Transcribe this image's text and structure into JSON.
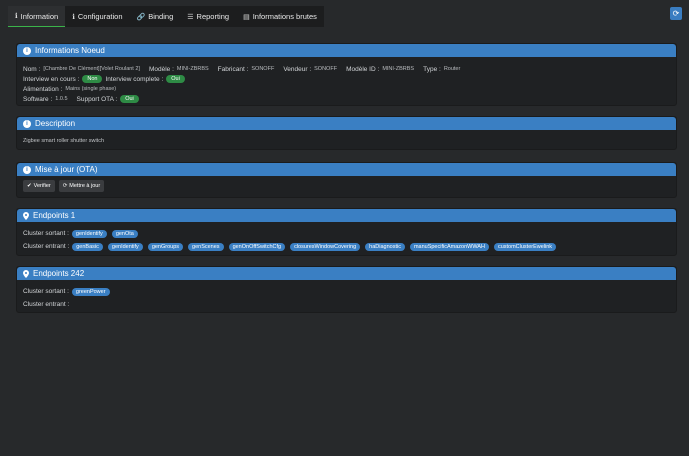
{
  "tabs": [
    {
      "label": "Information",
      "icon": "info-icon"
    },
    {
      "label": "Configuration",
      "icon": "info-icon"
    },
    {
      "label": "Binding",
      "icon": "link-icon"
    },
    {
      "label": "Reporting",
      "icon": "list-icon"
    },
    {
      "label": "Informations brutes",
      "icon": "table-icon"
    }
  ],
  "info": {
    "title": "Informations Noeud",
    "nom_label": "Nom :",
    "nom": "[Chambre De Clément][Volet Roulant 2]",
    "modele_label": "Modèle :",
    "modele": "MINI-ZBRBS",
    "fabricant_label": "Fabricant :",
    "fabricant": "SONOFF",
    "vendeur_label": "Vendeur :",
    "vendeur": "SONOFF",
    "modele_id_label": "Modèle ID :",
    "modele_id": "MINI-ZBRBS",
    "type_label": "Type :",
    "type": "Router",
    "interview_label": "Interview en cours :",
    "interview": "Non",
    "interview_complete_label": "Interview complete :",
    "interview_complete": "Oui",
    "alimentation_label": "Alimentation :",
    "alimentation": "Mains (single phase)",
    "software_label": "Software :",
    "software": "1.0.5",
    "ota_label": "Support OTA :",
    "ota": "Oui"
  },
  "description": {
    "title": "Description",
    "text": "Zigbee smart roller shutter switch"
  },
  "ota": {
    "title": "Mise à jour (OTA)",
    "verify": "Verifier",
    "update": "Mettre à jour"
  },
  "ep1": {
    "title": "Endpoints 1",
    "out_label": "Cluster sortant :",
    "out": [
      "genIdentify",
      "genOta"
    ],
    "in_label": "Cluster entrant :",
    "in": [
      "genBasic",
      "genIdentify",
      "genGroups",
      "genScenes",
      "genOnOffSwitchCfg",
      "closuresWindowCovering",
      "haDiagnostic",
      "manuSpecificAmazonWWAH",
      "customClusterEwelink"
    ]
  },
  "ep242": {
    "title": "Endpoints 242",
    "out_label": "Cluster sortant :",
    "out": [
      "greenPower"
    ],
    "in_label": "Cluster entrant :"
  }
}
